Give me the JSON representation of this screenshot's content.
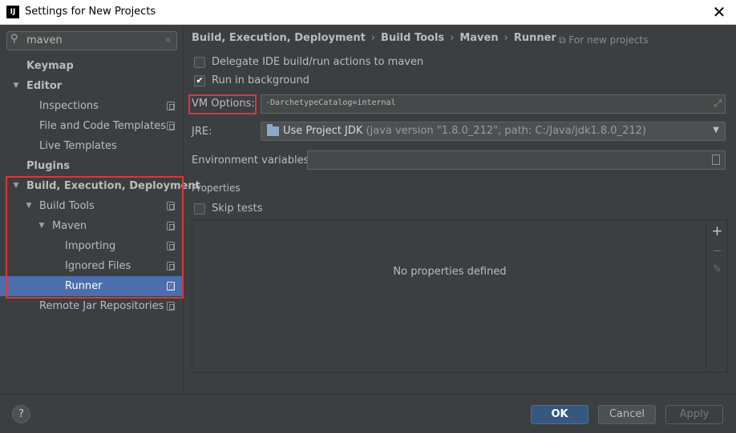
{
  "window": {
    "app_icon_text": "IJ",
    "title": "Settings for New Projects",
    "close_glyph": "✕"
  },
  "sidebar": {
    "search": {
      "value": "maven",
      "icon": "search-icon",
      "clear_glyph": "×"
    },
    "items": [
      {
        "label": "Keymap",
        "bold": true,
        "arrow": "",
        "copy_icon": false
      },
      {
        "label": "Editor",
        "bold": true,
        "arrow": "▼",
        "copy_icon": false
      },
      {
        "label": "Inspections",
        "bold": false,
        "arrow": "",
        "copy_icon": true
      },
      {
        "label": "File and Code Templates",
        "bold": false,
        "arrow": "",
        "copy_icon": true
      },
      {
        "label": "Live Templates",
        "bold": false,
        "arrow": "",
        "copy_icon": false
      },
      {
        "label": "Plugins",
        "bold": true,
        "arrow": "",
        "copy_icon": false
      },
      {
        "label": "Build, Execution, Deployment",
        "bold": true,
        "arrow": "▼",
        "copy_icon": false
      },
      {
        "label": "Build Tools",
        "bold": false,
        "arrow": "▼",
        "copy_icon": true
      },
      {
        "label": "Maven",
        "bold": false,
        "arrow": "▼",
        "copy_icon": true
      },
      {
        "label": "Importing",
        "bold": false,
        "arrow": "",
        "copy_icon": true
      },
      {
        "label": "Ignored Files",
        "bold": false,
        "arrow": "",
        "copy_icon": true
      },
      {
        "label": "Runner",
        "bold": false,
        "arrow": "",
        "copy_icon": true,
        "selected": true
      },
      {
        "label": "Remote Jar Repositories",
        "bold": false,
        "arrow": "",
        "copy_icon": true
      }
    ]
  },
  "breadcrumb": {
    "items": [
      "Build, Execution, Deployment",
      "Build Tools",
      "Maven",
      "Runner"
    ],
    "separator": "›",
    "scope_note": "For new projects",
    "scope_icon": "copy-icon"
  },
  "runner": {
    "delegate_checkbox": {
      "label": "Delegate IDE build/run actions to maven",
      "checked": false
    },
    "background_checkbox": {
      "label": "Run in background",
      "checked": true,
      "check_glyph": "✔"
    },
    "vm_options": {
      "label": "VM Options:",
      "value": "-DarchetypeCatalog=internal",
      "expand_glyph": "⤢"
    },
    "jre": {
      "label": "JRE:",
      "value": "Use Project JDK",
      "detail": "(java version \"1.8.0_212\", path: C:/Java/jdk1.8.0_212)",
      "caret": "▼"
    },
    "env": {
      "label": "Environment variables:",
      "value": ""
    }
  },
  "properties": {
    "section_title": "Properties",
    "skip_tests": {
      "label": "Skip tests",
      "checked": false
    },
    "empty_text": "No properties defined",
    "toolbar": {
      "add": "+",
      "remove": "−",
      "edit": "✎"
    }
  },
  "footer": {
    "help": "?",
    "ok": "OK",
    "cancel": "Cancel",
    "apply": "Apply"
  },
  "colors": {
    "background": "#3c3f41",
    "selection": "#4b6eaf",
    "highlight_box": "#e0343b",
    "ok_button": "#365880"
  }
}
